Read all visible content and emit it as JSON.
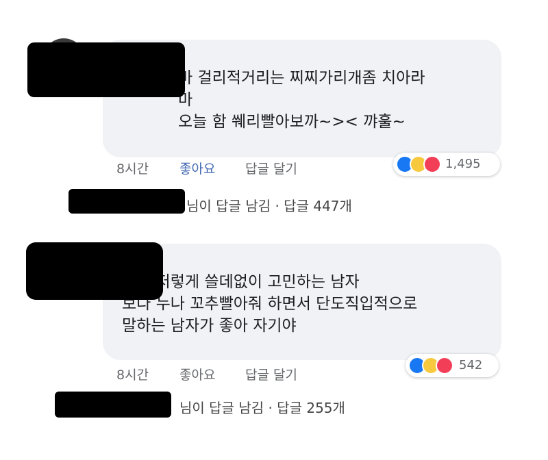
{
  "comments": [
    {
      "text": "마 걸리적거리는 찌찌가리개좀 치아라\n마\n오늘 함 쒜리빨아보까~>< 꺄훌~",
      "time": "8시간",
      "like_label": "좋아요",
      "like_active": true,
      "reply_label": "답글 달기",
      "reaction_count": "1,495",
      "reactions": [
        "like-icon",
        "haha-icon",
        "love-icon"
      ],
      "replies_summary": "님이 답글 남김 · 답글 447개"
    },
    {
      "text": "나는 저렇게 쓸데없이 고민하는 남자\n보다 누나 꼬추빨아줘 하면서 단도직입적으로\n말하는 남자가 좋아 자기야",
      "time": "8시간",
      "like_label": "좋아요",
      "like_active": false,
      "reply_label": "답글 달기",
      "reaction_count": "542",
      "reactions": [
        "like-icon",
        "haha-icon",
        "love-icon"
      ],
      "replies_summary": "님이 답글 남김 · 답글 255개"
    }
  ],
  "colors": {
    "bubble": "#f0f2f5",
    "like_active": "#4267b2",
    "meta": "#65676b",
    "like_reaction": "#1877f2",
    "haha_reaction": "#f7c93e",
    "love_reaction": "#f33e58"
  }
}
